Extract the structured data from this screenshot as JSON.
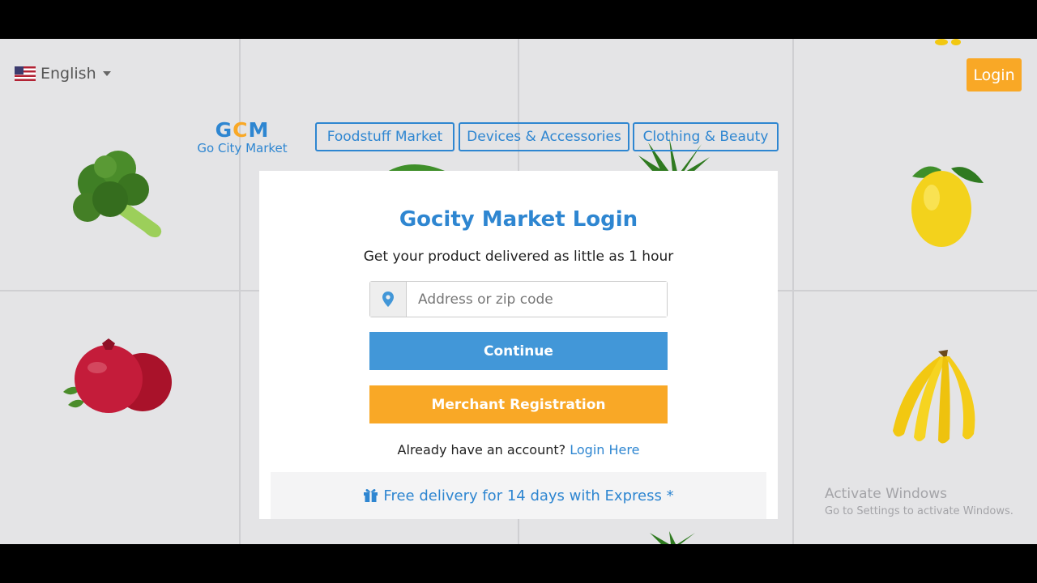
{
  "header": {
    "language_label": "English",
    "login_label": "Login"
  },
  "logo": {
    "mark": "GCM",
    "text": "Go City Market"
  },
  "nav": {
    "items": [
      {
        "label": "Foodstuff Market"
      },
      {
        "label": "Devices & Accessories"
      },
      {
        "label": "Clothing & Beauty"
      }
    ]
  },
  "login_card": {
    "title": "Gocity Market Login",
    "subtitle": "Get your product delivered as little as 1 hour",
    "address_placeholder": "Address or zip code",
    "address_value": "",
    "continue_label": "Continue",
    "merchant_label": "Merchant Registration",
    "account_prompt": "Already have an account?",
    "login_here_label": "Login Here",
    "promo_text": "Free delivery for 14 days with Express *"
  },
  "watermark": {
    "line1": "Activate Windows",
    "line2": "Go to Settings to activate Windows."
  },
  "colors": {
    "brand_blue": "#2e86d1",
    "button_blue": "#4297d8",
    "brand_orange": "#f9a826"
  },
  "icons": [
    "us-flag-icon",
    "caret-down-icon",
    "map-marker-icon",
    "gift-icon"
  ]
}
